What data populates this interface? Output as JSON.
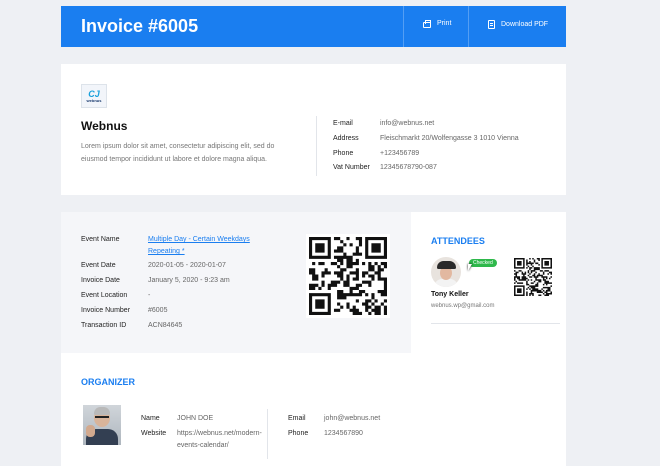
{
  "header": {
    "title": "Invoice #6005",
    "print_label": "Print",
    "download_label": "Download PDF",
    "color": "#1a7ef0"
  },
  "company": {
    "logo_glyph": "CJ",
    "logo_text": "webnus",
    "name": "Webnus",
    "description": "Lorem ipsum dolor sit amet, consectetur adipiscing elit, sed do eiusmod tempor incididunt ut labore et dolore magna aliqua.",
    "contact": [
      {
        "key": "E-mail",
        "value": "info@webnus.net"
      },
      {
        "key": "Address",
        "value": "Fleischmarkt 20/Wolfengasse 3 1010 Vienna"
      },
      {
        "key": "Phone",
        "value": "+123456789"
      },
      {
        "key": "Vat Number",
        "value": "12345678790-087"
      }
    ]
  },
  "event": {
    "fields": [
      {
        "key": "Event Name",
        "value": "Multiple Day - Certain Weekdays Repeating *"
      },
      {
        "key": "Event Date",
        "value": "2020-01-05 - 2020-01-07"
      },
      {
        "key": "Invoice Date",
        "value": "January 5, 2020 - 9:23 am"
      },
      {
        "key": "Event Location",
        "value": "-"
      },
      {
        "key": "Invoice Number",
        "value": "#6005"
      },
      {
        "key": "Transaction ID",
        "value": "ACN84645"
      }
    ]
  },
  "organizer": {
    "title": "ORGANIZER",
    "name_key": "Name",
    "name": "JOHN DOE",
    "website_key": "Website",
    "website": "https://webnus.net/modern-events-calendar/",
    "email_key": "Email",
    "email": "john@webnus.net",
    "phone_key": "Phone",
    "phone": "1234567890"
  },
  "attendees": {
    "title": "ATTENDEES",
    "items": [
      {
        "name": "Tony Keller",
        "email": "webnus.wp@gmail.com",
        "status": "Checked"
      }
    ]
  },
  "colors": {
    "accent": "#1a7ef0",
    "checked": "#2eb84b",
    "background": "#eef0f4"
  }
}
